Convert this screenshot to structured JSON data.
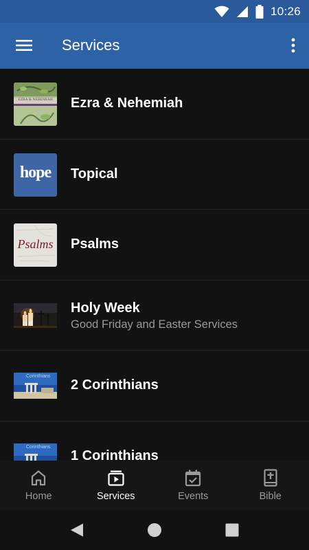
{
  "status_bar": {
    "time": "10:26",
    "icons": [
      "wifi-icon",
      "cell-signal-icon",
      "battery-icon"
    ]
  },
  "app_bar": {
    "title": "Services",
    "background": "#2e62a6",
    "menu_icon": "hamburger-menu-icon",
    "more_icon": "more-vertical-icon"
  },
  "services": [
    {
      "title": "Ezra & Nehemiah",
      "subtitle": "",
      "thumb_text": "EZRA & NEHEMIAH"
    },
    {
      "title": "Topical",
      "subtitle": "",
      "thumb_text": "hope"
    },
    {
      "title": "Psalms",
      "subtitle": "",
      "thumb_text": "Psalms"
    },
    {
      "title": "Holy Week",
      "subtitle": "Good Friday and Easter Services",
      "thumb_text": ""
    },
    {
      "title": "2 Corinthians",
      "subtitle": "",
      "thumb_text": "Corinthians"
    },
    {
      "title": "1 Corinthians",
      "subtitle": "",
      "thumb_text": "Corinthians"
    }
  ],
  "bottom_nav": [
    {
      "label": "Home",
      "icon": "home-icon",
      "active": false
    },
    {
      "label": "Services",
      "icon": "play-playlist-icon",
      "active": true
    },
    {
      "label": "Events",
      "icon": "calendar-check-icon",
      "active": false
    },
    {
      "label": "Bible",
      "icon": "bible-icon",
      "active": false
    }
  ],
  "system_nav": [
    "back-icon",
    "home-circle-icon",
    "recents-icon"
  ]
}
